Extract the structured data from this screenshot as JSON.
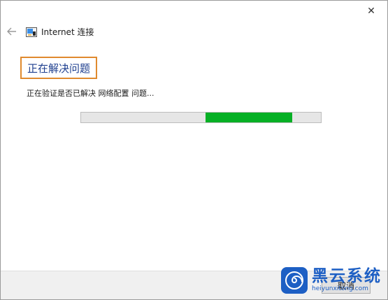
{
  "window": {
    "title": "Internet 连接",
    "close_glyph": "✕",
    "back_glyph": "←"
  },
  "main": {
    "heading": "正在解决问题",
    "status": "正在验证是否已解决 网络配置 问题...",
    "progress": {
      "start": 0.52,
      "end": 0.88
    }
  },
  "footer": {
    "cancel_label": "取消"
  },
  "watermark": {
    "brand": "黑云系统",
    "url": "heiyunxitong.com"
  },
  "colors": {
    "heading": "#1e3f8f",
    "highlight_border": "#e08a2e",
    "progress_fill": "#06b025",
    "watermark": "#1d5fc4"
  },
  "icons": {
    "back": "back-arrow-icon",
    "close": "close-icon",
    "app": "network-troubleshooter-icon",
    "watermark": "spiral-logo-icon"
  }
}
